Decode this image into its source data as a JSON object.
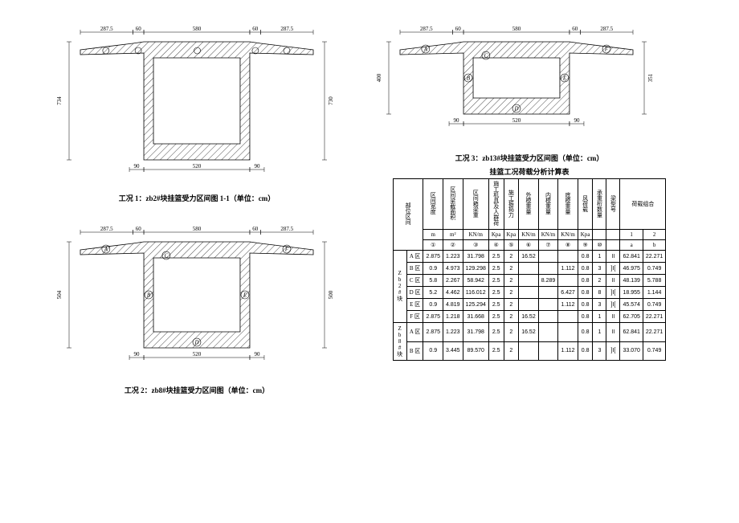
{
  "captions": {
    "fig1": "工况 1：zb2#块挂篮受力区间图 1-1（单位：cm）",
    "fig2": "工况 2：zb8#块挂篮受力区间图（单位：cm）",
    "fig3": "工况 3：zb13#块挂篮受力区间图（单位：cm）",
    "tableTitle": "挂篮工况荷载分析计算表"
  },
  "dims": {
    "top": [
      "287.5",
      "60",
      "580",
      "60",
      "287.5"
    ],
    "bottom": [
      "90",
      "520",
      "90"
    ],
    "fig1_h": [
      "734",
      "730"
    ],
    "fig2_h": [
      "504",
      "500"
    ],
    "fig3_h": [
      "400",
      "351"
    ]
  },
  "zoneLabels": [
    "A",
    "B",
    "C",
    "D",
    "E",
    "F"
  ],
  "table": {
    "headers": {
      "loc": "部位区间",
      "c1": "区间宽度",
      "c2": "区间梁截面积",
      "c3": "区间箱梁重",
      "c4": "施工机具及人群荷",
      "c5": "施工振捣力",
      "c6": "外模重量",
      "c7": "内模重量",
      "c8": "底模重量",
      "c9": "风荷载",
      "c10": "承重桁数量",
      "c11": "梁型号",
      "c12": "荷载组合",
      "units": [
        "m",
        "m²",
        "KN/m",
        "Kpa",
        "Kpa",
        "KN/m",
        "KN/m",
        "KN/m",
        "Kpa",
        "",
        "",
        "",
        ""
      ],
      "idx": [
        "①",
        "②",
        "③",
        "④",
        "⑤",
        "⑥",
        "⑦",
        "⑧",
        "⑨",
        "⑩",
        "",
        "",
        ""
      ],
      "sub12": [
        "1",
        "2"
      ],
      "sub12b": [
        "a",
        "b"
      ]
    },
    "rows": [
      {
        "grp": "Zb2#块",
        "zone": "A 区",
        "v": [
          "2.875",
          "1.223",
          "31.798",
          "2.5",
          "2",
          "16.52",
          "",
          "",
          "0.8",
          "1",
          "II",
          "62.841",
          "22.271"
        ]
      },
      {
        "zone": "B 区",
        "v": [
          "0.9",
          "4.973",
          "129.298",
          "2.5",
          "2",
          "",
          "",
          "1.112",
          "0.8",
          "3",
          "]I[",
          "46.975",
          "0.749"
        ]
      },
      {
        "zone": "C 区",
        "v": [
          "5.8",
          "2.267",
          "58.942",
          "2.5",
          "2",
          "",
          "8.289",
          "",
          "0.8",
          "2",
          "II",
          "48.139",
          "5.788"
        ]
      },
      {
        "zone": "D 区",
        "v": [
          "5.2",
          "4.462",
          "116.012",
          "2.5",
          "2",
          "",
          "",
          "6.427",
          "0.8",
          "8",
          "]I[",
          "18.955",
          "1.144"
        ]
      },
      {
        "zone": "E 区",
        "v": [
          "0.9",
          "4.819",
          "125.294",
          "2.5",
          "2",
          "",
          "",
          "1.112",
          "0.8",
          "3",
          "]I[",
          "45.574",
          "0.749"
        ]
      },
      {
        "zone": "F 区",
        "v": [
          "2.875",
          "1.218",
          "31.668",
          "2.5",
          "2",
          "16.52",
          "",
          "",
          "0.8",
          "1",
          "II",
          "62.705",
          "22.271"
        ]
      },
      {
        "grp": "Zb8#块",
        "zone": "A 区",
        "v": [
          "2.875",
          "1.223",
          "31.798",
          "2.5",
          "2",
          "16.52",
          "",
          "",
          "0.8",
          "1",
          "II",
          "62.841",
          "22.271"
        ]
      },
      {
        "zone": "B 区",
        "v": [
          "0.9",
          "3.445",
          "89.570",
          "2.5",
          "2",
          "",
          "",
          "1.112",
          "0.8",
          "3",
          "]I[",
          "33.070",
          "0.749"
        ]
      }
    ]
  }
}
